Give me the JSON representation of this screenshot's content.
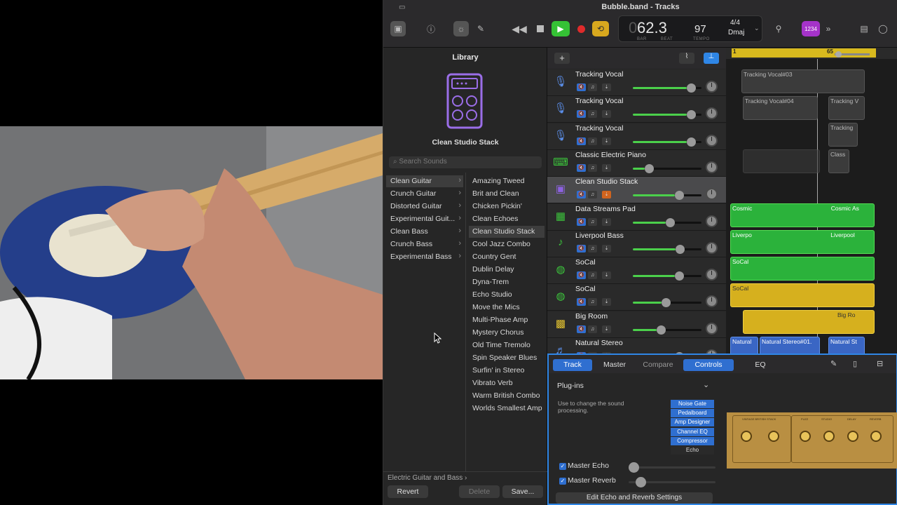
{
  "window": {
    "title": "Bubble.band - Tracks"
  },
  "lcd": {
    "bar": "62.3",
    "bar_label": "BAR",
    "beat_label": "BEAT",
    "tempo": "97",
    "tempo_label": "TEMPO",
    "signature": "4/4",
    "key": "Dmaj"
  },
  "toolbar": {
    "count_in": "1234"
  },
  "library": {
    "title": "Library",
    "preset_name": "Clean Studio Stack",
    "search_placeholder": "Search Sounds",
    "categories": [
      "Clean Guitar",
      "Crunch Guitar",
      "Distorted Guitar",
      "Experimental Guit...",
      "Clean Bass",
      "Crunch Bass",
      "Experimental Bass"
    ],
    "sounds": [
      "Amazing Tweed",
      "Brit and Clean",
      "Chicken Pickin'",
      "Clean Echoes",
      "Clean Studio Stack",
      "Cool Jazz Combo",
      "Country Gent",
      "Dublin Delay",
      "Dyna-Trem",
      "Echo Studio",
      "Move the Mics",
      "Multi-Phase Amp",
      "Mystery Chorus",
      "Old Time Tremolo",
      "Spin Speaker Blues",
      "Surfin' in Stereo",
      "Vibrato Verb",
      "Warm British Combo",
      "Worlds Smallest Amp"
    ],
    "breadcrumb": "Electric Guitar and Bass",
    "revert": "Revert",
    "delete": "Delete",
    "save": "Save..."
  },
  "tracks": [
    {
      "name": "Tracking Vocal",
      "icon": "microphone-icon",
      "volume": 0.9
    },
    {
      "name": "Tracking Vocal",
      "icon": "microphone-icon",
      "volume": 0.9
    },
    {
      "name": "Tracking Vocal",
      "icon": "microphone-icon",
      "volume": 0.9
    },
    {
      "name": "Classic Electric Piano",
      "icon": "piano-icon",
      "volume": 0.2
    },
    {
      "name": "Clean Studio Stack",
      "icon": "amp-icon",
      "volume": 0.7
    },
    {
      "name": "Data Streams Pad",
      "icon": "keyboard-icon",
      "volume": 0.55
    },
    {
      "name": "Liverpool Bass",
      "icon": "bass-icon",
      "volume": 0.72
    },
    {
      "name": "SoCal",
      "icon": "drums-icon",
      "volume": 0.7
    },
    {
      "name": "SoCal",
      "icon": "drums-icon",
      "volume": 0.48
    },
    {
      "name": "Big Room",
      "icon": "drum-machine-icon",
      "volume": 0.4
    },
    {
      "name": "Natural Stereo",
      "icon": "guitar-icon",
      "volume": 0.7
    }
  ],
  "ruler": {
    "start": "1",
    "marker": "65"
  },
  "regions": {
    "vocal1": "Tracking Vocal#03",
    "vocal2a": "Tracking Vocal#04",
    "vocal2b": "Tracking V",
    "vocal3": "Tracking",
    "piano": "Class",
    "pad": "Cosmic",
    "pad2": "Cosmic As",
    "bass": "Liverpo",
    "bass2": "Liverpool",
    "drums": "SoCal",
    "drums2": "SoCal",
    "bigroom": "Big Ro",
    "natural1": "Natural",
    "natural2": "Natural Stereo#01.",
    "natural3": "Natural St"
  },
  "editor": {
    "tabs": [
      "Track",
      "Master",
      "Compare",
      "Controls",
      "EQ"
    ],
    "plugins_title": "Plug-ins",
    "plugins_desc": "Use to change the sound processing.",
    "plugins": [
      "Noise Gate",
      "Pedalboard",
      "Amp Designer",
      "Channel EQ",
      "Compressor",
      "Echo"
    ],
    "master_echo": "Master Echo",
    "master_reverb": "Master Reverb",
    "edit_settings": "Edit Echo and Reverb Settings",
    "amp_sections": [
      "VINTAGE BRITISH STACK",
      "FUZZ",
      "STUDIO",
      "DELAY",
      "REVERB"
    ]
  },
  "colors": {
    "accent": "#2f86e6",
    "green": "#2bb23b",
    "yellow": "#d6b01e",
    "play": "#35c235",
    "record": "#e02b2b"
  }
}
